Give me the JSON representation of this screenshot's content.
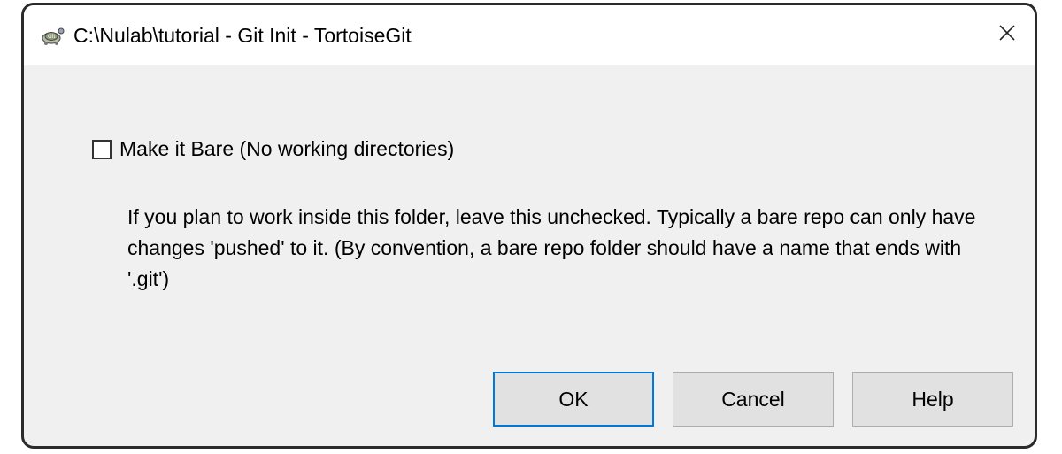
{
  "window": {
    "title": "C:\\Nulab\\tutorial - Git Init - TortoiseGit",
    "app_icon": "tortoisegit-icon",
    "close_icon": "close-icon"
  },
  "options": {
    "bare_checkbox": {
      "label": "Make it Bare (No working directories)",
      "checked": false
    },
    "description": "If you plan to work inside this folder, leave this unchecked. Typically a bare repo can only have changes 'pushed' to it. (By convention, a bare repo folder should have a name that ends with '.git')"
  },
  "buttons": {
    "ok_label": "OK",
    "cancel_label": "Cancel",
    "help_label": "Help"
  },
  "colors": {
    "default_button_border": "#0078d7",
    "dialog_background": "#f0f0f0"
  }
}
